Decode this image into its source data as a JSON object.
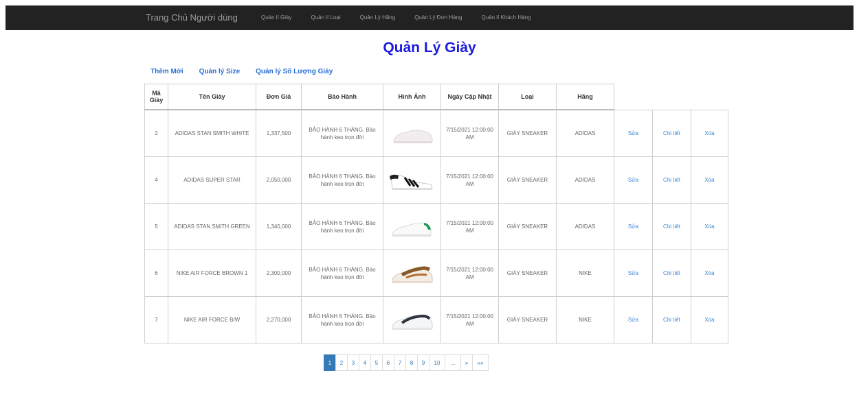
{
  "navbar": {
    "brand": "Trang Chủ Người dùng",
    "links": [
      "Quản lí Giày",
      "Quản lí Loại",
      "Quản Lý Hãng",
      "Quản Lý Đơn Hàng",
      "Quản lí Khách Hàng"
    ]
  },
  "page_title": "Quản Lý Giày",
  "actions": [
    "Thêm Mới",
    "Quản lý Size",
    "Quản lý Số Lượng Giày"
  ],
  "table": {
    "headers": [
      "Mã Giày",
      "Tên Giày",
      "Đơn Giá",
      "Bảo Hành",
      "Hình Ảnh",
      "Ngày Cập Nhật",
      "Loại",
      "Hãng"
    ],
    "rows": [
      {
        "id": "2",
        "name": "ADIDAS STAN SMITH WHITE",
        "price": "1,337,500",
        "warranty": "BẢO HÀNH 6 THÁNG. Bảo hành keo trọn đời",
        "image": "white-sneaker",
        "updated": "7/15/2021 12:00:00 AM",
        "category": "GIÀY SNEAKER",
        "brand": "ADIDAS"
      },
      {
        "id": "4",
        "name": "ADIDAS SUPER STAR",
        "price": "2,050,000",
        "warranty": "BẢO HÀNH 6 THÁNG. Bảo hành keo trọn đời",
        "image": "superstar-sneaker",
        "updated": "7/15/2021 12:00:00 AM",
        "category": "GIÀY SNEAKER",
        "brand": "ADIDAS"
      },
      {
        "id": "5",
        "name": "ADIDAS STAN SMITH GREEN",
        "price": "1,340,000",
        "warranty": "BẢO HÀNH 6 THÁNG. Bảo hành keo trọn đời",
        "image": "green-heel-sneaker",
        "updated": "7/15/2021 12:00:00 AM",
        "category": "GIÀY SNEAKER",
        "brand": "ADIDAS"
      },
      {
        "id": "6",
        "name": "NIKE AIR FORCE BROWN 1",
        "price": "2,300,000",
        "warranty": "BẢO HÀNH 6 THÁNG. Bảo hành keo trọn đời",
        "image": "brown-sneaker",
        "updated": "7/15/2021 12:00:00 AM",
        "category": "GIÀY SNEAKER",
        "brand": "NIKE"
      },
      {
        "id": "7",
        "name": "NIKE AIR FORCE B/W",
        "price": "2,270,000",
        "warranty": "BẢO HÀNH 6 THÁNG. Bảo hành keo trọn đời",
        "image": "black-white-sneaker",
        "updated": "7/15/2021 12:00:00 AM",
        "category": "GIÀY SNEAKER",
        "brand": "NIKE"
      }
    ],
    "row_actions": {
      "edit": "Sửa",
      "detail": "Chi tiết",
      "delete": "Xóa"
    }
  },
  "pagination": {
    "pages": [
      "1",
      "2",
      "3",
      "4",
      "5",
      "6",
      "7",
      "8",
      "9",
      "10",
      "...",
      "»",
      "»»"
    ],
    "active": "1"
  },
  "colors": {
    "accent": "#337ab7",
    "title": "#1b1bdf",
    "navbar": "#222222"
  }
}
